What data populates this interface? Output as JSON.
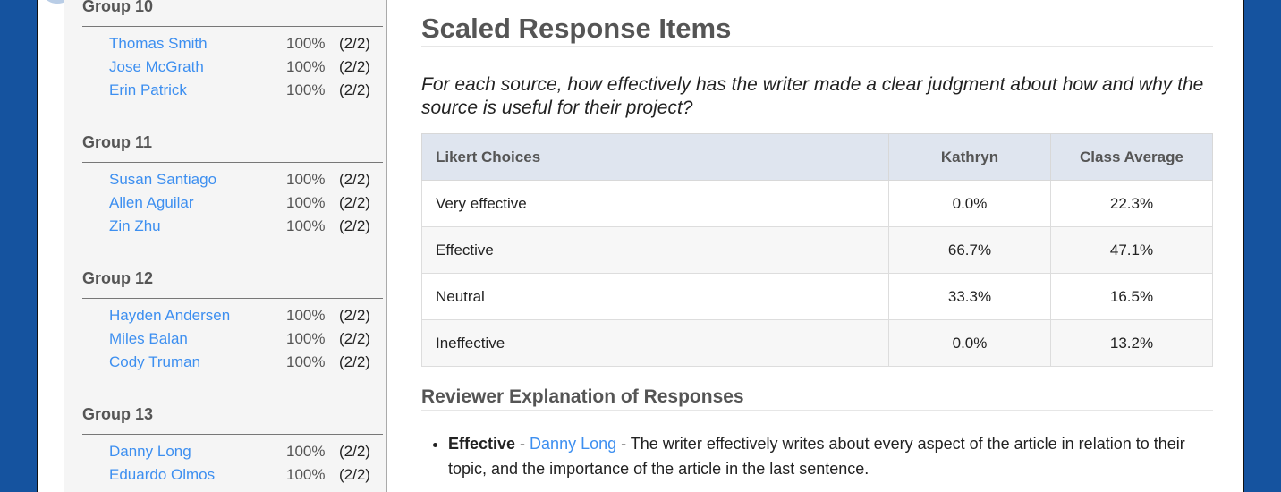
{
  "sidebar": {
    "groups": [
      {
        "title": "Group 10",
        "members": [
          {
            "name": "Thomas Smith",
            "percent": "100%",
            "fraction": "(2/2)"
          },
          {
            "name": "Jose McGrath",
            "percent": "100%",
            "fraction": "(2/2)"
          },
          {
            "name": "Erin Patrick",
            "percent": "100%",
            "fraction": "(2/2)"
          }
        ]
      },
      {
        "title": "Group 11",
        "members": [
          {
            "name": "Susan Santiago",
            "percent": "100%",
            "fraction": "(2/2)"
          },
          {
            "name": "Allen Aguilar",
            "percent": "100%",
            "fraction": "(2/2)"
          },
          {
            "name": "Zin Zhu",
            "percent": "100%",
            "fraction": "(2/2)"
          }
        ]
      },
      {
        "title": "Group 12",
        "members": [
          {
            "name": "Hayden Andersen",
            "percent": "100%",
            "fraction": "(2/2)"
          },
          {
            "name": "Miles Balan",
            "percent": "100%",
            "fraction": "(2/2)"
          },
          {
            "name": "Cody Truman",
            "percent": "100%",
            "fraction": "(2/2)"
          }
        ]
      },
      {
        "title": "Group 13",
        "members": [
          {
            "name": "Danny Long",
            "percent": "100%",
            "fraction": "(2/2)"
          },
          {
            "name": "Eduardo Olmos",
            "percent": "100%",
            "fraction": "(2/2)"
          }
        ]
      }
    ]
  },
  "main": {
    "title": "Scaled Response Items",
    "question": "For each source, how effectively has the writer made a clear judgment about how and why the source is useful for their project?",
    "table": {
      "headers": [
        "Likert Choices",
        "Kathryn",
        "Class Average"
      ],
      "rows": [
        [
          "Very effective",
          "0.0%",
          "22.3%"
        ],
        [
          "Effective",
          "66.7%",
          "47.1%"
        ],
        [
          "Neutral",
          "33.3%",
          "16.5%"
        ],
        [
          "Ineffective",
          "0.0%",
          "13.2%"
        ]
      ]
    },
    "explanations_title": "Reviewer Explanation of Responses",
    "explanations": [
      {
        "choice": "Effective",
        "sep1": " - ",
        "reviewer": "Danny Long",
        "text": " - The writer effectively writes about every aspect of the article in relation to their topic, and the importance of the article in the last sentence."
      }
    ]
  }
}
